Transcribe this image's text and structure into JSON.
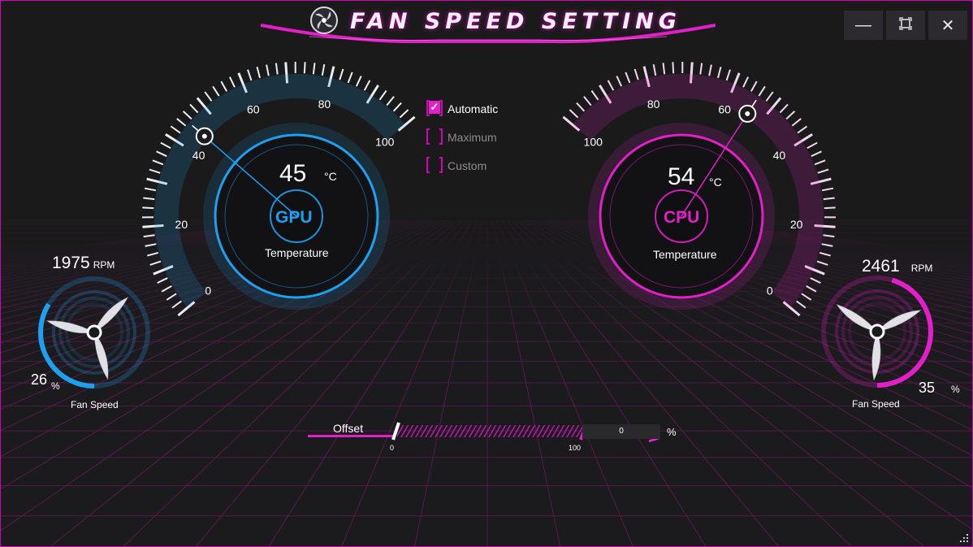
{
  "window": {
    "title": "FAN SPEED SETTING",
    "minimize_icon": "minimize-icon",
    "restore_icon": "restore-icon",
    "close_icon": "close-icon"
  },
  "colors": {
    "gpu_accent": "#1ea0f0",
    "cpu_accent": "#e21fc8",
    "background": "#1b1a1c"
  },
  "gpu": {
    "chip": "GPU",
    "temperature": "45",
    "unit": "°C",
    "temperature_label": "Temperature",
    "scale_labels": [
      "0",
      "20",
      "40",
      "60",
      "80",
      "100"
    ],
    "temperature_value": 45,
    "fan": {
      "rpm": "1975",
      "rpm_unit": "RPM",
      "percent": "26",
      "percent_sign": "%",
      "fan_speed_fraction": 0.26,
      "label": "Fan Speed"
    }
  },
  "cpu": {
    "chip": "CPU",
    "temperature": "54",
    "unit": "°C",
    "temperature_label": "Temperature",
    "scale_labels": [
      "0",
      "20",
      "40",
      "60",
      "80",
      "100"
    ],
    "temperature_value": 54,
    "fan": {
      "rpm": "2461",
      "rpm_unit": "RPM",
      "percent": "35",
      "percent_sign": "%",
      "fan_speed_fraction": 0.35,
      "label": "Fan Speed"
    }
  },
  "modes": [
    {
      "label": "Automatic",
      "checked": true
    },
    {
      "label": "Maximum",
      "checked": false
    },
    {
      "label": "Custom",
      "checked": false
    }
  ],
  "offset": {
    "label": "Offset",
    "min_label": "0",
    "max_label": "100",
    "value": "0",
    "unit": "%"
  }
}
